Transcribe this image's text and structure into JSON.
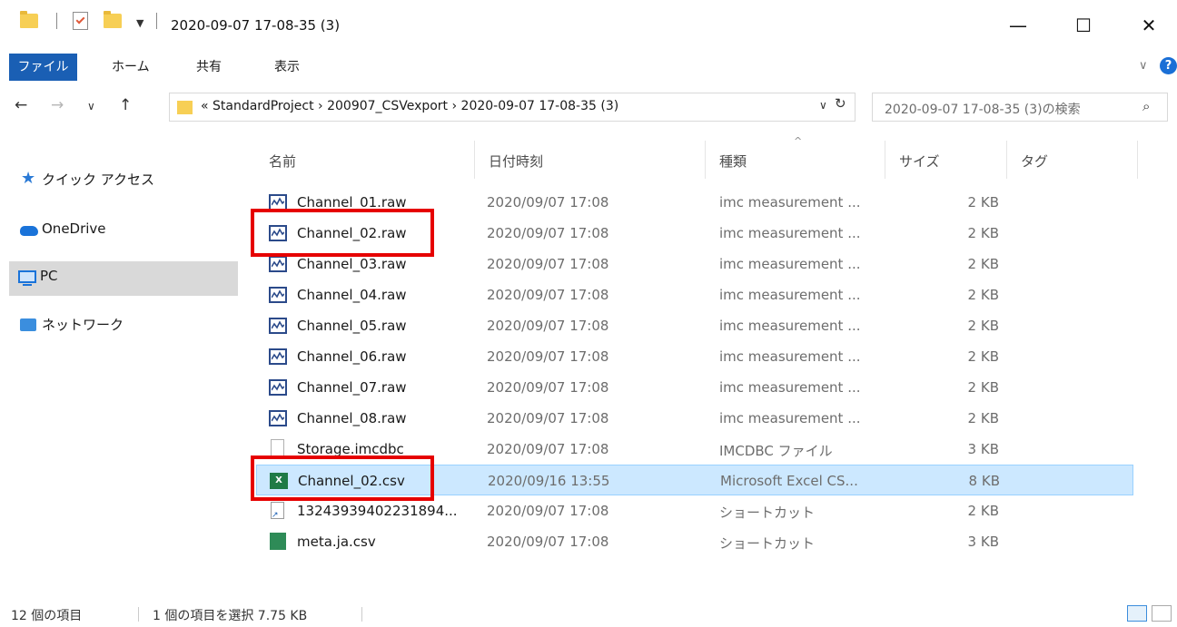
{
  "window": {
    "title": "2020-09-07 17-08-35 (3)",
    "minimize": "—",
    "maximize": "☐",
    "close": "✕"
  },
  "ribbon": {
    "tabs": [
      "ファイル",
      "ホーム",
      "共有",
      "表示"
    ],
    "expand": "∨",
    "help": "?"
  },
  "nav": {
    "back": "←",
    "forward": "→",
    "recent": "∨",
    "up": "↑"
  },
  "address": {
    "path": "« StandardProject  ›  200907_CSVexport  ›  2020-09-07 17-08-35 (3)",
    "dropdown": "∨",
    "refresh": "↻"
  },
  "search": {
    "placeholder": "2020-09-07 17-08-35 (3)の検索",
    "icon": "⌕"
  },
  "sidebar": {
    "items": [
      {
        "label": "クイック アクセス",
        "icon": "star-icon"
      },
      {
        "label": "OneDrive",
        "icon": "cloud-icon"
      },
      {
        "label": "PC",
        "icon": "computer-icon"
      },
      {
        "label": "ネットワーク",
        "icon": "network-icon"
      }
    ],
    "selected": "PC"
  },
  "columns": {
    "name": "名前",
    "date": "日付時刻",
    "type": "種類",
    "size": "サイズ",
    "tag": "タグ",
    "sort_indicator": "^"
  },
  "files": [
    {
      "name": "Channel_01.raw",
      "date": "2020/09/07 17:08",
      "type": "imc measurement ...",
      "size": "2 KB",
      "icon": "raw"
    },
    {
      "name": "Channel_02.raw",
      "date": "2020/09/07 17:08",
      "type": "imc measurement ...",
      "size": "2 KB",
      "icon": "raw"
    },
    {
      "name": "Channel_03.raw",
      "date": "2020/09/07 17:08",
      "type": "imc measurement ...",
      "size": "2 KB",
      "icon": "raw"
    },
    {
      "name": "Channel_04.raw",
      "date": "2020/09/07 17:08",
      "type": "imc measurement ...",
      "size": "2 KB",
      "icon": "raw"
    },
    {
      "name": "Channel_05.raw",
      "date": "2020/09/07 17:08",
      "type": "imc measurement ...",
      "size": "2 KB",
      "icon": "raw"
    },
    {
      "name": "Channel_06.raw",
      "date": "2020/09/07 17:08",
      "type": "imc measurement ...",
      "size": "2 KB",
      "icon": "raw"
    },
    {
      "name": "Channel_07.raw",
      "date": "2020/09/07 17:08",
      "type": "imc measurement ...",
      "size": "2 KB",
      "icon": "raw"
    },
    {
      "name": "Channel_08.raw",
      "date": "2020/09/07 17:08",
      "type": "imc measurement ...",
      "size": "2 KB",
      "icon": "raw"
    },
    {
      "name": "Storage.imcdbc",
      "date": "2020/09/07 17:08",
      "type": "IMCDBC ファイル",
      "size": "3 KB",
      "icon": "file"
    },
    {
      "name": "Channel_02.csv",
      "date": "2020/09/16 13:55",
      "type": "Microsoft Excel CS...",
      "size": "8 KB",
      "icon": "excel"
    },
    {
      "name": "13243939402231894...",
      "date": "2020/09/07 17:08",
      "type": "ショートカット",
      "size": "2 KB",
      "icon": "shortcut"
    },
    {
      "name": "meta.ja.csv",
      "date": "2020/09/07 17:08",
      "type": "ショートカット",
      "size": "3 KB",
      "icon": "csv-shortcut"
    }
  ],
  "selected_file": "Channel_02.csv",
  "status": {
    "count": "12 個の項目",
    "selection": "1 個の項目を選択  7.75 KB"
  },
  "colors": {
    "file_tab": "#1a5fb4",
    "selected_row": "#cce8ff",
    "highlight_box": "#e60000",
    "excel_icon": "#1f7a45"
  }
}
